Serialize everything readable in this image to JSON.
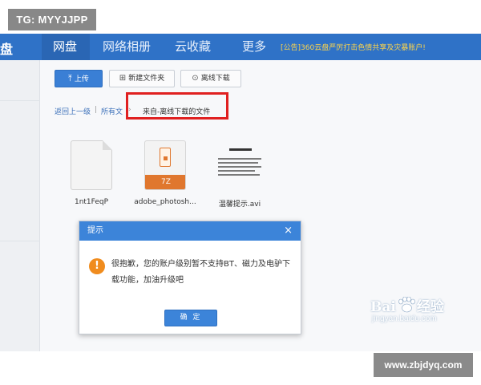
{
  "watermark_tag": "TG: MYYJJPP",
  "site_tag": "www.zbjdyq.com",
  "nav": {
    "logo": "盘",
    "tabs": [
      "网盘",
      "网络相册",
      "云收藏",
      "更多"
    ],
    "active_tab": "网盘",
    "notice": "[公告]360云盘严厉打击色情共享及灾暴账户!"
  },
  "toolbar": {
    "upload": "上传",
    "new_folder": "新建文件夹",
    "offline_download": "离线下载"
  },
  "breadcrumb": {
    "back": "返回上一级",
    "sep": "|",
    "all": "所有文",
    "arrow": "›",
    "current": "来自-离线下载的文件"
  },
  "files": [
    {
      "name": "1nt1FeqP",
      "type": "document"
    },
    {
      "name": "adobe_photosh...",
      "type": "zip",
      "badge": "7Z"
    },
    {
      "name": "温馨提示.avi",
      "type": "video",
      "thumb_title": "温馨提示"
    }
  ],
  "modal": {
    "title": "提示",
    "close": "×",
    "icon": "!",
    "message": "很抱歉，您的账户级别暂不支持BT、磁力及电驴下载功能，加油升级吧",
    "ok": "确 定"
  },
  "baidu": {
    "logo_left": "Bai",
    "logo_right": "经验",
    "url": "jingyan.baidu.com"
  },
  "colors": {
    "nav_blue": "#2f72c7",
    "accent": "#3c84d9",
    "highlight_red": "#e02020",
    "warning_orange": "#f08c1e",
    "zip_orange": "#e0772e"
  }
}
